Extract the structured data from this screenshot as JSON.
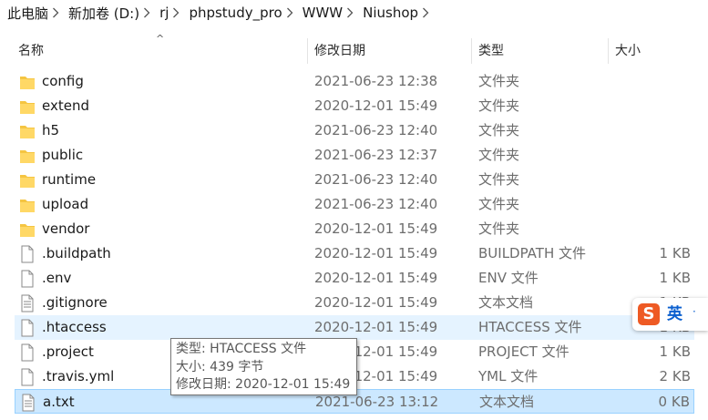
{
  "breadcrumb": [
    "此电脑",
    "新加卷 (D:)",
    "rj",
    "phpstudy_pro",
    "WWW",
    "Niushop"
  ],
  "columns": {
    "name": "名称",
    "date": "修改日期",
    "type": "类型",
    "size": "大小"
  },
  "rows": [
    {
      "name": "config",
      "date": "2021-06-23 12:38",
      "type": "文件夹",
      "size": "",
      "kind": "folder"
    },
    {
      "name": "extend",
      "date": "2020-12-01 15:49",
      "type": "文件夹",
      "size": "",
      "kind": "folder"
    },
    {
      "name": "h5",
      "date": "2021-06-23 12:40",
      "type": "文件夹",
      "size": "",
      "kind": "folder"
    },
    {
      "name": "public",
      "date": "2021-06-23 12:37",
      "type": "文件夹",
      "size": "",
      "kind": "folder"
    },
    {
      "name": "runtime",
      "date": "2021-06-23 12:40",
      "type": "文件夹",
      "size": "",
      "kind": "folder"
    },
    {
      "name": "upload",
      "date": "2021-06-23 12:40",
      "type": "文件夹",
      "size": "",
      "kind": "folder"
    },
    {
      "name": "vendor",
      "date": "2020-12-01 15:49",
      "type": "文件夹",
      "size": "",
      "kind": "folder"
    },
    {
      "name": ".buildpath",
      "date": "2020-12-01 15:49",
      "type": "BUILDPATH 文件",
      "size": "1 KB",
      "kind": "file"
    },
    {
      "name": ".env",
      "date": "2020-12-01 15:49",
      "type": "ENV 文件",
      "size": "1 KB",
      "kind": "file"
    },
    {
      "name": ".gitignore",
      "date": "2020-12-01 15:49",
      "type": "文本文档",
      "size": "1 KB",
      "kind": "text"
    },
    {
      "name": ".htaccess",
      "date": "2020-12-01 15:49",
      "type": "HTACCESS 文件",
      "size": "1 KB",
      "kind": "file",
      "state": "hover"
    },
    {
      "name": ".project",
      "date": "2020-12-01 15:49",
      "type": "PROJECT 文件",
      "size": "1 KB",
      "kind": "file"
    },
    {
      "name": ".travis.yml",
      "date": "2020-12-01 15:49",
      "type": "YML 文件",
      "size": "2 KB",
      "kind": "file"
    },
    {
      "name": "a.txt",
      "date": "2021-06-23 13:12",
      "type": "文本文档",
      "size": "0 KB",
      "kind": "text",
      "state": "selected"
    }
  ],
  "tooltip": {
    "line1": "类型: HTACCESS 文件",
    "line2": "大小: 439 字节",
    "line3": "修改日期: 2020-12-01 15:49"
  },
  "ime": {
    "logo": "S",
    "label": "英",
    "dot": "·"
  },
  "colors": {
    "folder": "#f5c542",
    "hover": "#e5f3ff",
    "selected": "#cce8ff"
  }
}
